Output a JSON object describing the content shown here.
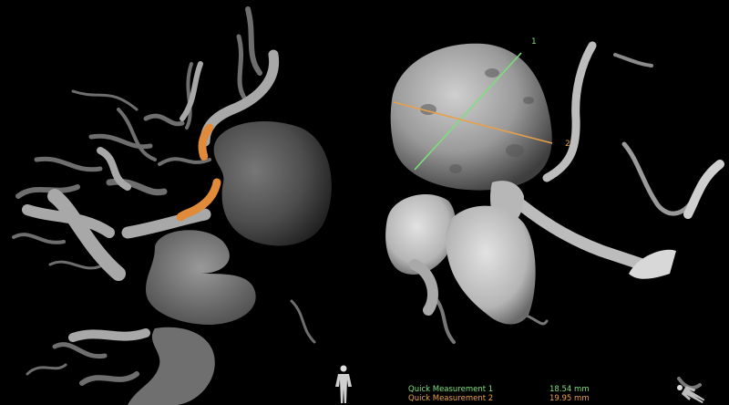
{
  "colors": {
    "background": "#000000",
    "vessel": "#8c8c8c",
    "measurement_1": "#7be07b",
    "measurement_2": "#e8a04a"
  },
  "measurement_labels": {
    "line_1": "1",
    "line_2": "2"
  },
  "measurements": [
    {
      "label": "Quick Measurement 1",
      "value": "18.54 mm"
    },
    {
      "label": "Quick Measurement 2",
      "value": "19.95 mm"
    }
  ],
  "icons": {
    "orientation_figure": "human-figure-icon",
    "orientation_figure_right": "human-figure-rotated-icon"
  }
}
